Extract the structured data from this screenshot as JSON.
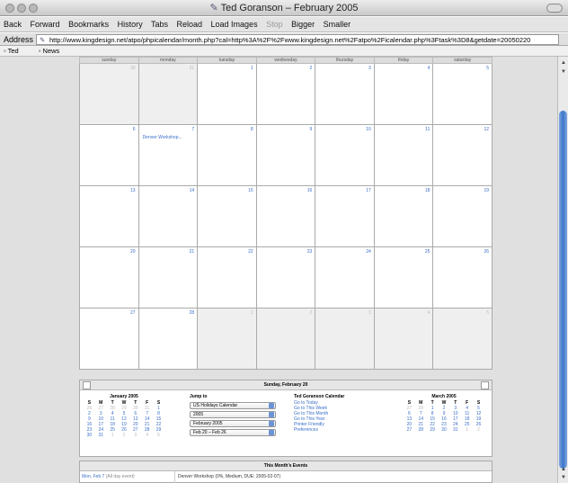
{
  "window": {
    "title": "Ted Goranson – February 2005"
  },
  "toolbar": {
    "items": [
      "Back",
      "Forward",
      "Bookmarks",
      "History",
      "Tabs",
      "Reload",
      "Load Images",
      "Stop",
      "Bigger",
      "Smaller"
    ]
  },
  "address": {
    "label": "Address",
    "url": "http://www.kingdesign.net/atpo/phpicalendar/month.php?cal=http%3A%2F%2Fwww.kingdesign.net%2Fatpo%2Ficalendar.php%3Ftask%3D8&getdate=20050220"
  },
  "bookmarks": {
    "items": [
      "Ted",
      "News"
    ]
  },
  "calendar": {
    "weekdays": [
      "sunday",
      "monday",
      "tuesday",
      "wednesday",
      "thursday",
      "friday",
      "saturday"
    ],
    "weeks": [
      [
        {
          "d": "30",
          "o": true
        },
        {
          "d": "31",
          "o": true
        },
        {
          "d": "1"
        },
        {
          "d": "2"
        },
        {
          "d": "3"
        },
        {
          "d": "4"
        },
        {
          "d": "5"
        }
      ],
      [
        {
          "d": "6"
        },
        {
          "d": "7",
          "ev": "Denver Workshop..."
        },
        {
          "d": "8"
        },
        {
          "d": "9"
        },
        {
          "d": "10"
        },
        {
          "d": "11"
        },
        {
          "d": "12"
        }
      ],
      [
        {
          "d": "13"
        },
        {
          "d": "14"
        },
        {
          "d": "15"
        },
        {
          "d": "16"
        },
        {
          "d": "17"
        },
        {
          "d": "18"
        },
        {
          "d": "19"
        }
      ],
      [
        {
          "d": "20"
        },
        {
          "d": "21"
        },
        {
          "d": "22"
        },
        {
          "d": "23"
        },
        {
          "d": "24"
        },
        {
          "d": "25"
        },
        {
          "d": "26"
        }
      ],
      [
        {
          "d": "27"
        },
        {
          "d": "28"
        },
        {
          "d": "1",
          "o": true
        },
        {
          "d": "2",
          "o": true
        },
        {
          "d": "3",
          "o": true
        },
        {
          "d": "4",
          "o": true
        },
        {
          "d": "5",
          "o": true
        }
      ]
    ]
  },
  "panel": {
    "title": "Sunday, February 20",
    "jump": {
      "title": "Jump to",
      "selects": [
        "US Holidays Calendar",
        "2005",
        "February 2005",
        "Feb 20 – Feb 26"
      ]
    },
    "links": {
      "title": "Ted Goranson Calendar",
      "items": [
        "Go to Today",
        "Go to This Week",
        "Go to This Month",
        "Go to This Year",
        "Printer Friendly",
        "Preferences"
      ]
    },
    "left_mini": {
      "title": "January 2005",
      "head": [
        "S",
        "M",
        "T",
        "W",
        "T",
        "F",
        "S"
      ],
      "rows": [
        [
          [
            "26",
            1
          ],
          [
            "27",
            1
          ],
          [
            "28",
            1
          ],
          [
            "29",
            1
          ],
          [
            "30",
            1
          ],
          [
            "31",
            1
          ],
          [
            "1",
            0
          ]
        ],
        [
          [
            "2",
            0
          ],
          [
            "3",
            0
          ],
          [
            "4",
            0
          ],
          [
            "5",
            0
          ],
          [
            "6",
            0
          ],
          [
            "7",
            0
          ],
          [
            "8",
            0
          ]
        ],
        [
          [
            "9",
            0
          ],
          [
            "10",
            0
          ],
          [
            "11",
            0
          ],
          [
            "12",
            0
          ],
          [
            "13",
            0
          ],
          [
            "14",
            0
          ],
          [
            "15",
            0
          ]
        ],
        [
          [
            "16",
            0
          ],
          [
            "17",
            0
          ],
          [
            "18",
            0
          ],
          [
            "19",
            0
          ],
          [
            "20",
            0
          ],
          [
            "21",
            0
          ],
          [
            "22",
            0
          ]
        ],
        [
          [
            "23",
            0
          ],
          [
            "24",
            0
          ],
          [
            "25",
            0
          ],
          [
            "26",
            0
          ],
          [
            "27",
            0
          ],
          [
            "28",
            0
          ],
          [
            "29",
            0
          ]
        ],
        [
          [
            "30",
            0
          ],
          [
            "31",
            0
          ],
          [
            "1",
            1
          ],
          [
            "2",
            1
          ],
          [
            "3",
            1
          ],
          [
            "4",
            1
          ],
          [
            "5",
            1
          ]
        ]
      ]
    },
    "right_mini": {
      "title": "March 2005",
      "head": [
        "S",
        "M",
        "T",
        "W",
        "T",
        "F",
        "S"
      ],
      "rows": [
        [
          [
            "27",
            1
          ],
          [
            "28",
            1
          ],
          [
            "1",
            0
          ],
          [
            "2",
            0
          ],
          [
            "3",
            0
          ],
          [
            "4",
            0
          ],
          [
            "5",
            0
          ]
        ],
        [
          [
            "6",
            0
          ],
          [
            "7",
            0
          ],
          [
            "8",
            0
          ],
          [
            "9",
            0
          ],
          [
            "10",
            0
          ],
          [
            "11",
            0
          ],
          [
            "12",
            0
          ]
        ],
        [
          [
            "13",
            0
          ],
          [
            "14",
            0
          ],
          [
            "15",
            0
          ],
          [
            "16",
            0
          ],
          [
            "17",
            0
          ],
          [
            "18",
            0
          ],
          [
            "19",
            0
          ]
        ],
        [
          [
            "20",
            0
          ],
          [
            "21",
            0
          ],
          [
            "22",
            0
          ],
          [
            "23",
            0
          ],
          [
            "24",
            0
          ],
          [
            "25",
            0
          ],
          [
            "26",
            0
          ]
        ],
        [
          [
            "27",
            0
          ],
          [
            "28",
            0
          ],
          [
            "29",
            0
          ],
          [
            "30",
            0
          ],
          [
            "31",
            0
          ],
          [
            "1",
            1
          ],
          [
            "2",
            1
          ]
        ]
      ]
    }
  },
  "events": {
    "title": "This Month's Events",
    "rows": [
      {
        "date": "Mon, Feb 7",
        "note": "(All day event)",
        "text": "Denver Workshop (0%, Medium, DUE: 2005-02-07)"
      }
    ]
  },
  "colors": {
    "link": "#3a6fc8",
    "scroll_thumb": "#3c76c9"
  }
}
